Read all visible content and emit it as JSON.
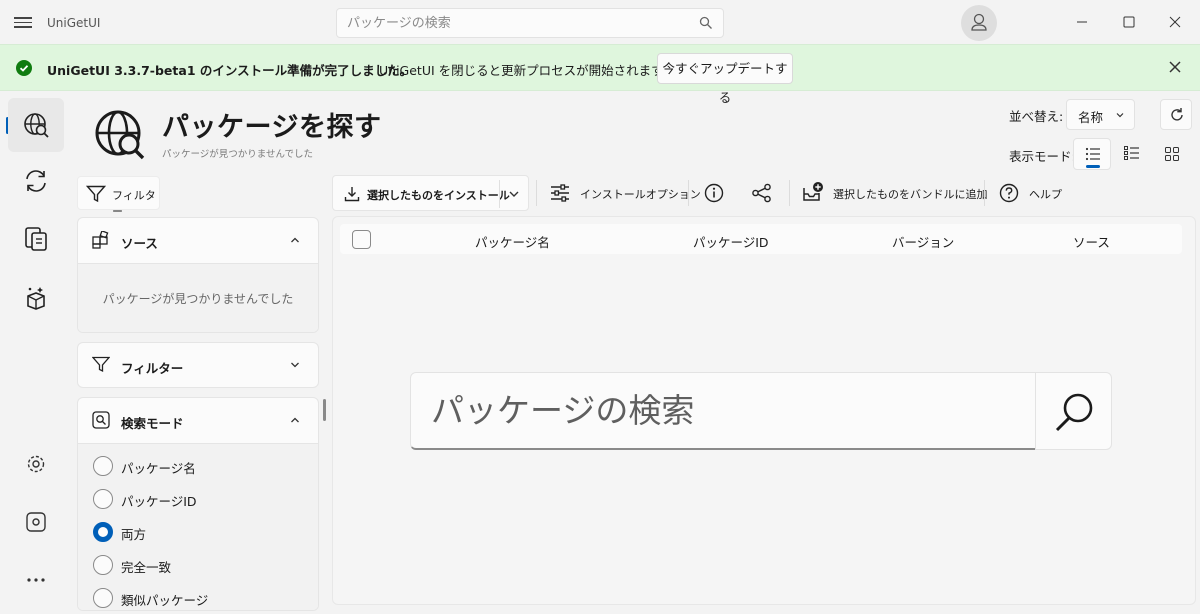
{
  "window": {
    "app_title": "UniGetUI",
    "search_placeholder": "パッケージの検索"
  },
  "notification": {
    "title": "UniGetUI 3.3.7-beta1 のインストール準備が完了しました。",
    "message": "UniGetUI を閉じると更新プロセスが開始されます",
    "button_label": "今すぐアップデートする",
    "status_color": "#107c10"
  },
  "nav": {
    "items": [
      {
        "name": "discover",
        "icon": "globe-search-icon",
        "active": true
      },
      {
        "name": "updates",
        "icon": "sync-icon",
        "active": false
      },
      {
        "name": "installed",
        "icon": "installed-packages-icon",
        "active": false
      },
      {
        "name": "bundles",
        "icon": "package-bundle-icon",
        "active": false
      }
    ],
    "bottom": [
      "settings-icon",
      "manager-settings-icon",
      "more-icon"
    ]
  },
  "header": {
    "title": "パッケージを探す",
    "subtitle": "パッケージが見つかりませんでした",
    "sort_label": "並べ替え:",
    "sort_value": "名称",
    "view_label": "表示モード:"
  },
  "filter_button": "フィルター",
  "panels": {
    "sources": {
      "title": "ソース",
      "empty": "パッケージが見つかりませんでした"
    },
    "filters": {
      "title": "フィルター"
    },
    "search_mode": {
      "title": "検索モード",
      "options": [
        "パッケージ名",
        "パッケージID",
        "両方",
        "完全一致",
        "類似パッケージ"
      ],
      "selected": "両方"
    }
  },
  "toolbar": {
    "install_selected": "選択したものをインストール",
    "install_options": "インストールオプション",
    "add_to_bundle": "選択したものをバンドルに追加",
    "help": "ヘルプ"
  },
  "table": {
    "columns": [
      "パッケージ名",
      "パッケージID",
      "バージョン",
      "ソース"
    ]
  },
  "big_search": {
    "placeholder": "パッケージの検索"
  },
  "colors": {
    "accent": "#005fb8",
    "success_bg": "#dff6dd"
  }
}
